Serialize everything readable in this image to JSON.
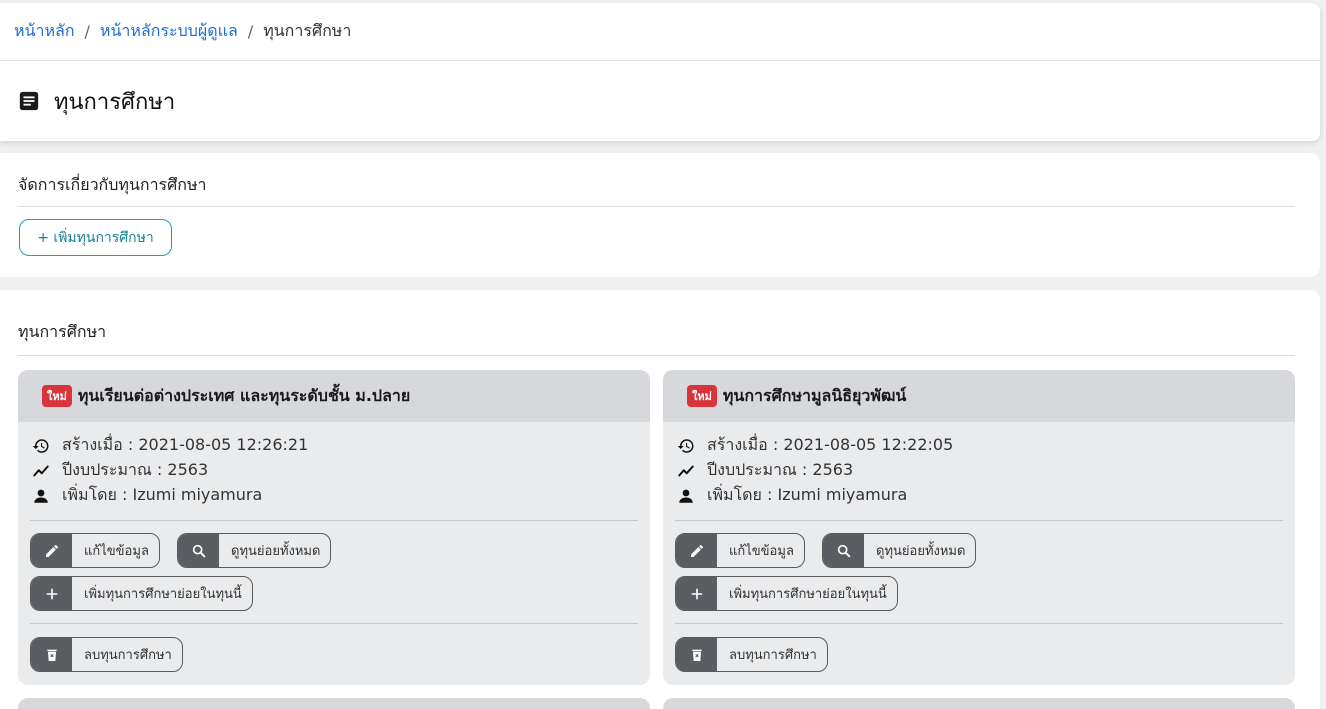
{
  "breadcrumb": {
    "home": "หน้าหลัก",
    "admin_home": "หน้าหลักระบบผู้ดูแล",
    "current": "ทุนการศึกษา",
    "separator": "/"
  },
  "page": {
    "title": "ทุนการศึกษา",
    "icon": "document-icon"
  },
  "manage_section": {
    "title": "จัดการเกี่ยวกับทุนการศึกษา",
    "add_button": "+ เพิ่มทุนการศึกษา"
  },
  "list_section": {
    "title": "ทุนการศึกษา"
  },
  "grants": [
    {
      "badge": "ใหม่",
      "title": "ทุนเรียนต่อต่างประเทศ และทุนระดับชั้น ม.ปลาย",
      "created": "สร้างเมื่อ : 2021-08-05 12:26:21",
      "budget_year": "ปีงบประมาณ : 2563",
      "added_by": "เพิ่มโดย : Izumi miyamura",
      "edit_label": "แก้ไขข้อมูล",
      "view_all_label": "ดูทุนย่อยทั้งหมด",
      "add_sub_label": "เพิ่มทุนการศึกษาย่อยในทุนนี้",
      "delete_label": "ลบทุนการศึกษา"
    },
    {
      "badge": "ใหม่",
      "title": "ทุนการศึกษามูลนิธิยุวพัฒน์",
      "created": "สร้างเมื่อ : 2021-08-05 12:22:05",
      "budget_year": "ปีงบประมาณ : 2563",
      "added_by": "เพิ่มโดย : Izumi miyamura",
      "edit_label": "แก้ไขข้อมูล",
      "view_all_label": "ดูทุนย่อยทั้งหมด",
      "add_sub_label": "เพิ่มทุนการศึกษาย่อยในทุนนี้",
      "delete_label": "ลบทุนการศึกษา"
    }
  ],
  "colors": {
    "link": "#1d6fd6",
    "accent_outline": "#17a2b8",
    "badge_bg": "#d9343a",
    "icon_block": "#5a5e63"
  }
}
